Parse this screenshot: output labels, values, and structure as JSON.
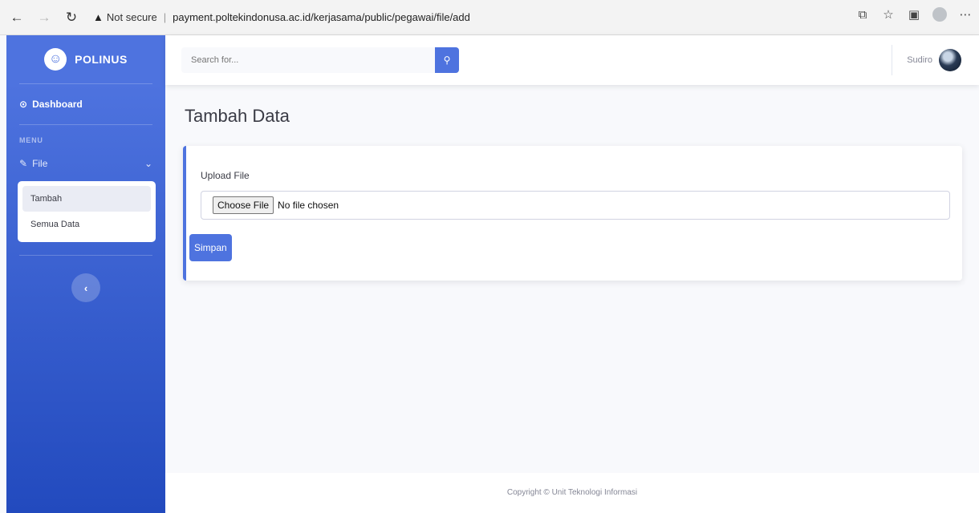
{
  "browser": {
    "back_icon": "←",
    "forward_icon": "→",
    "refresh_icon": "↻",
    "warning_icon": "▲",
    "security_label": "Not secure",
    "url": "payment.poltekindonusa.ac.id/kerjasama/public/pegawai/file/add",
    "icons": [
      "tab-icon",
      "favorite-icon",
      "collections-icon",
      "profile-icon",
      "more-icon"
    ]
  },
  "sidebar": {
    "brand_icon": "☺",
    "brand": "POLINUS",
    "dashboard_icon": "⊙",
    "dashboard": "Dashboard",
    "menu_heading": "MENU",
    "file_icon": "✎",
    "file_label": "File",
    "chevron": "⌄",
    "submenu": [
      {
        "label": "Tambah",
        "active": true
      },
      {
        "label": "Semua Data",
        "active": false
      }
    ],
    "toggle_icon": "‹"
  },
  "topbar": {
    "search_placeholder": "Search for...",
    "search_icon": "⚲",
    "user_name": "Sudiro"
  },
  "main": {
    "title": "Tambah Data",
    "field_label": "Upload File",
    "file_button": "Choose File",
    "file_status": "No file chosen",
    "submit": "Simpan"
  },
  "footer": {
    "copyright": "Copyright © Unit Teknologi Informasi"
  },
  "colors": {
    "primary": "#4e73df",
    "sidebar_dark": "#224abe"
  }
}
